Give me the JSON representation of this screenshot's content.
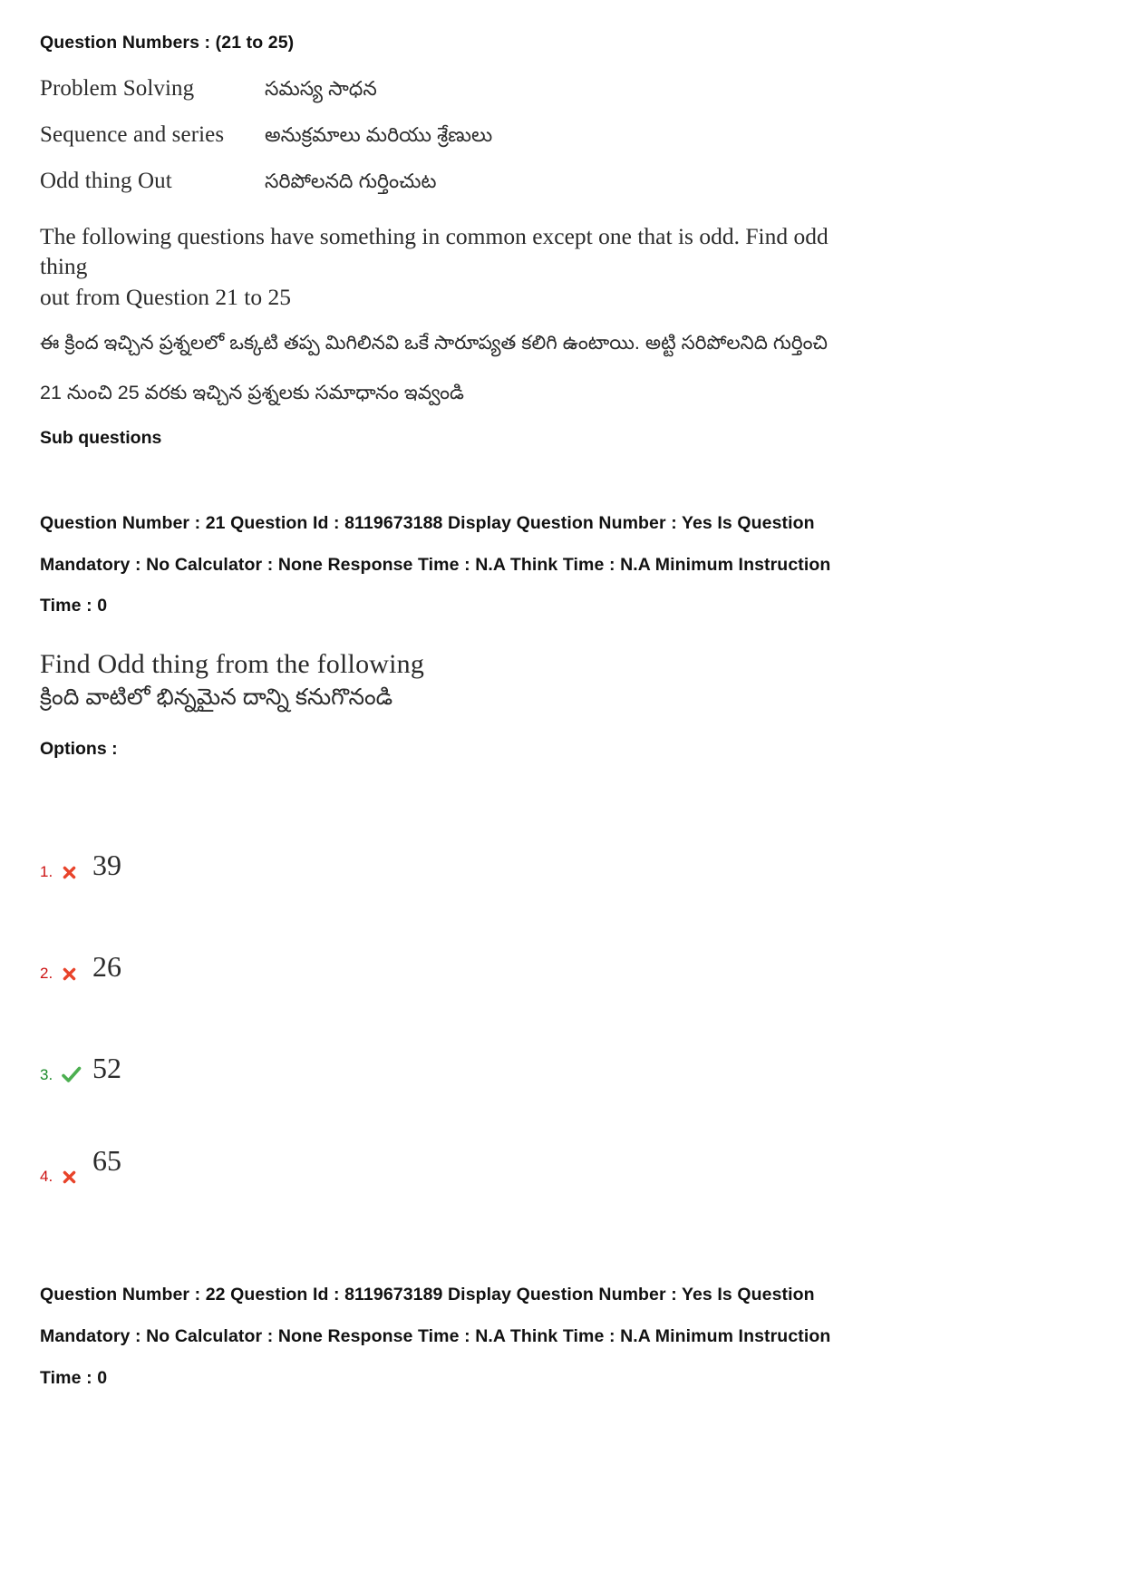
{
  "header": {
    "question_numbers_label": "Question Numbers : (21 to 25)"
  },
  "topics": [
    {
      "en": "Problem Solving",
      "te": "సమస్య సాధన"
    },
    {
      "en": "Sequence and series",
      "te": "అనుక్రమాలు మరియు శ్రేణులు"
    },
    {
      "en": "Odd thing Out",
      "te": "సరిపోలనది గుర్తించుట"
    }
  ],
  "instructions": {
    "en_line1": "The following questions have something in common except one that is odd. Find odd thing",
    "en_line2": "out from Question 21 to 25",
    "te_line1": "ఈ క్రింద ఇచ్చిన ప్రశ్నలలో ఒక్కటి తప్ప మిగిలినవి ఒకే సారూప్యత కలిగి ఉంటాయి. అట్టి సరిపోలనిది   గుర్తించి",
    "te_line2": "21 నుంచి 25 వరకు ఇచ్చిన ప్రశ్నలకు సమాధానం ఇవ్వండి"
  },
  "sub_questions_label": "Sub questions",
  "questions": [
    {
      "meta_line1": "Question Number : 21 Question Id : 8119673188 Display Question Number : Yes Is Question",
      "meta_line2": "Mandatory : No Calculator : None Response Time : N.A Think Time : N.A Minimum Instruction",
      "meta_line3": "Time : 0",
      "stem_en": "Find Odd thing from the following",
      "stem_te": "క్రింది వాటిలో భిన్నమైన దాన్ని కనుగొనండి",
      "options_label": "Options :",
      "options": [
        {
          "number": "1.",
          "mark": "cross-icon",
          "text": "39",
          "correct": false
        },
        {
          "number": "2.",
          "mark": "cross-icon",
          "text": "26",
          "correct": false
        },
        {
          "number": "3.",
          "mark": "check-icon",
          "text": "52",
          "correct": true
        },
        {
          "number": "4.",
          "mark": "cross-icon",
          "text": "65",
          "correct": false
        }
      ]
    },
    {
      "meta_line1": "Question Number : 22 Question Id : 8119673189 Display Question Number : Yes Is Question",
      "meta_line2": "Mandatory : No Calculator : None Response Time : N.A Think Time : N.A Minimum Instruction",
      "meta_line3": "Time : 0"
    }
  ],
  "colors": {
    "wrong": "#e8432a",
    "right": "#4caf50",
    "wrong_number": "#cc1111",
    "right_number": "#1b8a2a"
  }
}
